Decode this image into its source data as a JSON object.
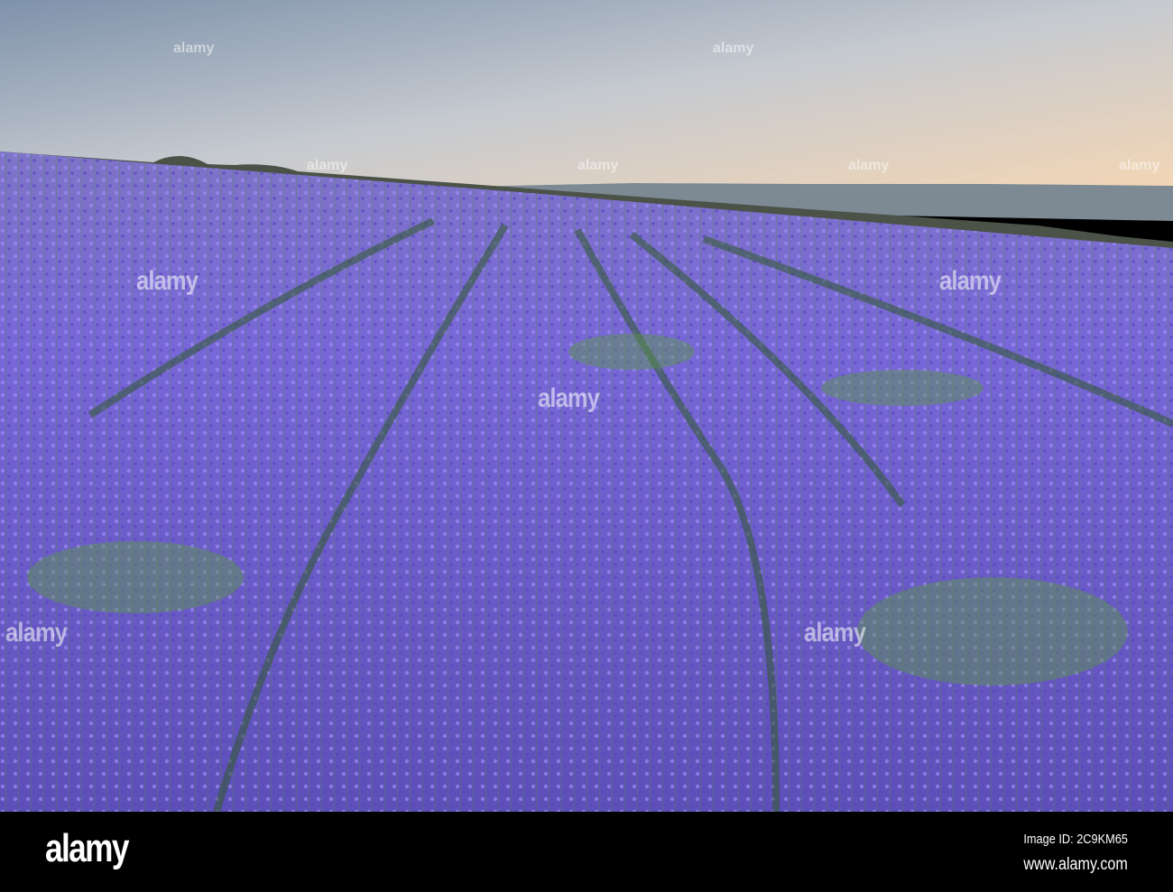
{
  "watermark": {
    "text": "alamy"
  },
  "footer": {
    "logo": "alamy",
    "image_id": "Image ID: 2C9KM65",
    "website": "www.alamy.com"
  },
  "colors": {
    "sky_top": "#7f93ac",
    "sky_horizon": "#f2d9b8",
    "lavender": "#7a6ad6",
    "stem": "#4f8a3a"
  }
}
